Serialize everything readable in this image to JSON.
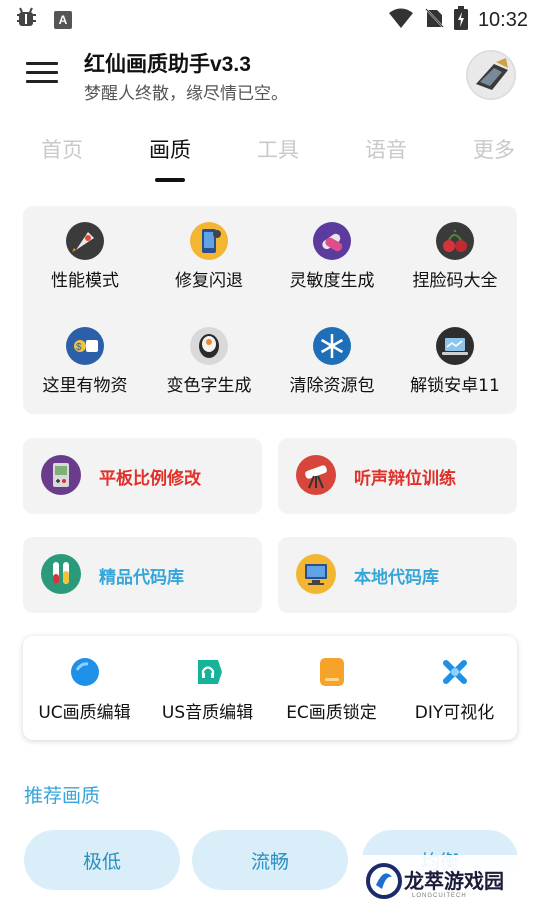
{
  "status_bar": {
    "time": "10:32",
    "icons": [
      "bug-icon",
      "text-a-icon",
      "wifi-icon",
      "no-sim-icon",
      "battery-charging-icon"
    ]
  },
  "header": {
    "title": "红仙画质助手v3.3",
    "subtitle": "梦醒人终散，缘尽情已空。"
  },
  "tabs": [
    {
      "label": "首页",
      "active": false
    },
    {
      "label": "画质",
      "active": true
    },
    {
      "label": "工具",
      "active": false
    },
    {
      "label": "语音",
      "active": false
    },
    {
      "label": "更多",
      "active": false
    }
  ],
  "function_grid": [
    {
      "label": "性能模式",
      "icon": "rocket-icon"
    },
    {
      "label": "修复闪退",
      "icon": "phone-repair-icon"
    },
    {
      "label": "灵敏度生成",
      "icon": "pills-icon"
    },
    {
      "label": "捏脸码大全",
      "icon": "cherries-icon"
    },
    {
      "label": "这里有物资",
      "icon": "money-icon"
    },
    {
      "label": "变色字生成",
      "icon": "sushi-icon"
    },
    {
      "label": "清除资源包",
      "icon": "snowflake-icon"
    },
    {
      "label": "解锁安卓11",
      "icon": "laptop-icon"
    }
  ],
  "wide_cards": [
    {
      "label": "平板比例修改",
      "icon": "gameboy-icon",
      "color": "#e0302a"
    },
    {
      "label": "听声辩位训练",
      "icon": "telescope-icon",
      "color": "#e0302a"
    },
    {
      "label": "精品代码库",
      "icon": "test-tubes-icon",
      "color": "#36a6d8"
    },
    {
      "label": "本地代码库",
      "icon": "monitor-icon",
      "color": "#36a6d8"
    }
  ],
  "editors": [
    {
      "label": "UC画质编辑",
      "icon": "blue-circle-icon"
    },
    {
      "label": "US音质编辑",
      "icon": "headset-icon"
    },
    {
      "label": "EC画质锁定",
      "icon": "document-icon"
    },
    {
      "label": "DIY可视化",
      "icon": "blue-x-icon"
    }
  ],
  "recommend": {
    "title": "推荐画质",
    "options": [
      "极低",
      "流畅",
      "均衡"
    ]
  },
  "watermark": {
    "text": "龙萃游戏园",
    "sub": "LONGCUITECH"
  },
  "colors": {
    "accent_blue": "#36a6d8",
    "accent_red": "#e0302a",
    "pill_bg": "#d9eef9"
  }
}
